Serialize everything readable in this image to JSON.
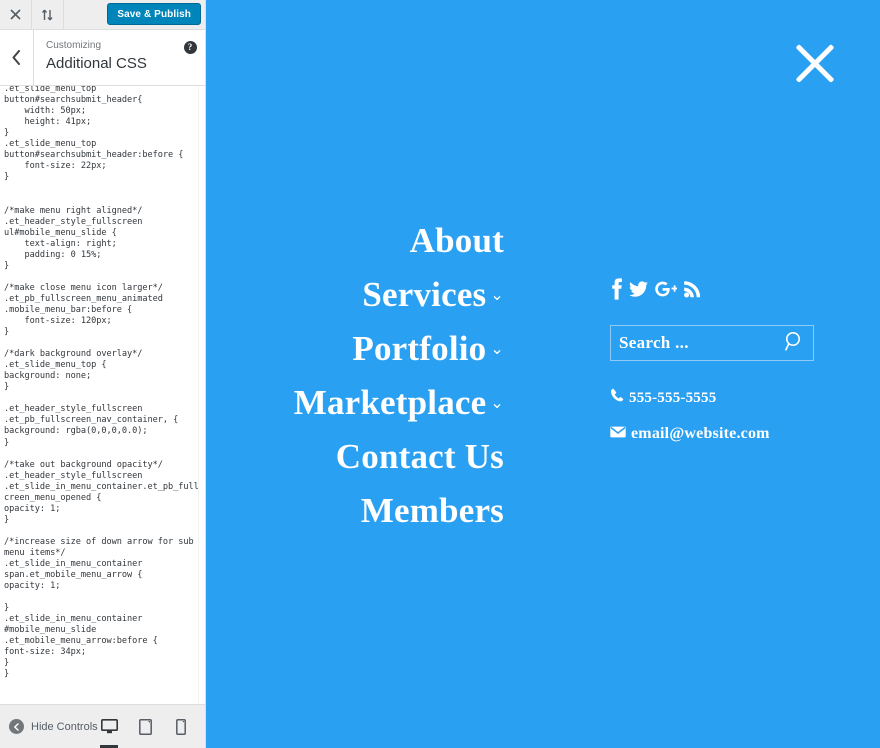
{
  "customizer": {
    "topbar": {
      "close_icon": "close-icon",
      "collapse_icon": "expand-collapse-icon",
      "save_label": "Save & Publish",
      "save_color": "#0085ba"
    },
    "panel": {
      "back_icon": "chevron-left-icon",
      "eyebrow": "Customizing",
      "title": "Additional CSS",
      "help_icon": "help-icon",
      "help_glyph": "?"
    },
    "editor": {
      "name": "additional-css-editor",
      "code": ".et_slide_menu_top\nbutton#searchsubmit_header{\n    width: 50px;\n    height: 41px;\n}\n.et_slide_menu_top\nbutton#searchsubmit_header:before {\n    font-size: 22px;\n}\n\n\n/*make menu right aligned*/\n.et_header_style_fullscreen\nul#mobile_menu_slide {\n    text-align: right;\n    padding: 0 15%;\n}\n\n/*make close menu icon larger*/\n.et_pb_fullscreen_menu_animated\n.mobile_menu_bar:before {\n    font-size: 120px;\n}\n\n/*dark background overlay*/\n.et_slide_menu_top {\nbackground: none;\n}\n\n.et_header_style_fullscreen\n.et_pb_fullscreen_nav_container, {\nbackground: rgba(0,0,0,0.0);\n}\n\n/*take out background opacity*/\n.et_header_style_fullscreen\n.et_slide_in_menu_container.et_pb_fulls\ncreen_menu_opened {\nopacity: 1;\n}\n\n/*increase size of down arrow for sub\nmenu items*/\n.et_slide_in_menu_container\nspan.et_mobile_menu_arrow {\nopacity: 1;\n\n}\n.et_slide_in_menu_container\n#mobile_menu_slide\n.et_mobile_menu_arrow:before {\nfont-size: 34px;\n}\n}"
    },
    "bottom": {
      "hide_controls_label": "Hide Controls",
      "hide_icon": "collapse-left-icon",
      "devices": [
        {
          "name": "desktop",
          "icon": "desktop-icon",
          "active": true
        },
        {
          "name": "tablet",
          "icon": "tablet-icon",
          "active": false
        },
        {
          "name": "mobile",
          "icon": "mobile-icon",
          "active": false
        }
      ]
    }
  },
  "preview": {
    "background_color": "#2aa0f2",
    "close_icon": "close-menu-icon",
    "nav_items": [
      {
        "label": "About",
        "has_submenu": false
      },
      {
        "label": "Services",
        "has_submenu": true
      },
      {
        "label": "Portfolio",
        "has_submenu": true
      },
      {
        "label": "Marketplace",
        "has_submenu": true
      },
      {
        "label": "Contact Us",
        "has_submenu": false
      },
      {
        "label": "Members",
        "has_submenu": false
      }
    ],
    "submenu_arrow": "⌄",
    "social": [
      {
        "name": "facebook-icon",
        "label": "f"
      },
      {
        "name": "twitter-icon",
        "label": "Twitter"
      },
      {
        "name": "google-plus-icon",
        "label": "G+"
      },
      {
        "name": "rss-icon",
        "label": "RSS"
      }
    ],
    "search": {
      "placeholder": "Search ...",
      "value": "",
      "icon": "search-icon"
    },
    "contact": {
      "phone": "555-555-5555",
      "phone_icon": "phone-icon",
      "email": "email@website.com",
      "email_icon": "envelope-icon"
    }
  }
}
